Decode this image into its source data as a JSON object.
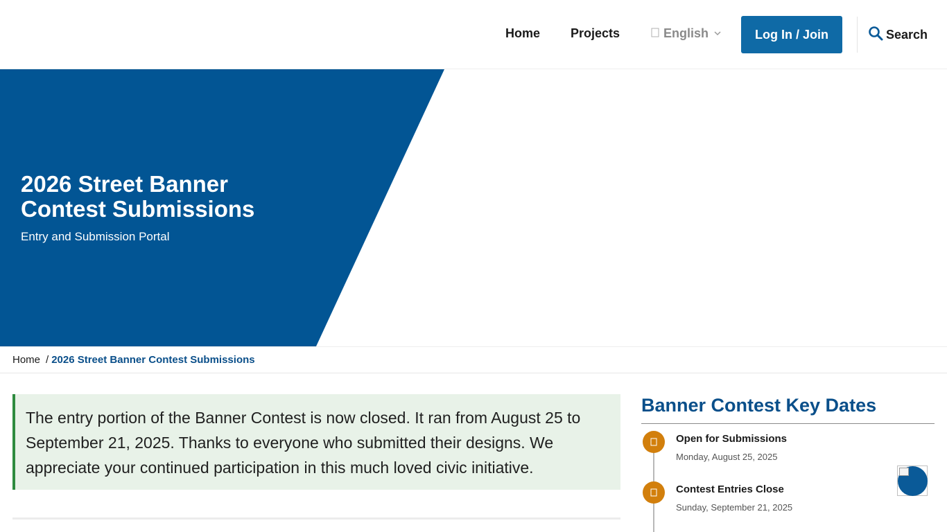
{
  "header": {
    "nav": {
      "home_label": "Home",
      "projects_label": "Projects"
    },
    "language": {
      "selected": "English",
      "icon": "globe-icon"
    },
    "login_label": "Log In / Join",
    "search_label": "Search"
  },
  "hero": {
    "title": "2026 Street Banner Contest Submissions",
    "subtitle": "Entry and Submission Portal",
    "brand_color": "#025594"
  },
  "breadcrumb": {
    "home_label": "Home",
    "separator": "/",
    "current_label": "2026 Street Banner Contest Submissions"
  },
  "notice": {
    "text": "The entry portion of the Banner Contest is now closed. It ran from August 25 to September 21, 2025. Thanks to everyone who submitted their designs. We appreciate your continued participation in this much loved civic initiative."
  },
  "key_dates": {
    "title": "Banner Contest Key Dates",
    "items": [
      {
        "title": "Open for Submissions",
        "date": "Monday, August 25, 2025",
        "icon": "calendar-icon"
      },
      {
        "title": "Contest Entries Close",
        "date": "Sunday, September 21, 2025",
        "icon": "calendar-icon"
      }
    ]
  },
  "colors": {
    "primary": "#0f6aa6",
    "accent_orange": "#d27f0c",
    "notice_bg": "#e8f2e8",
    "notice_border": "#2e8b3f"
  }
}
